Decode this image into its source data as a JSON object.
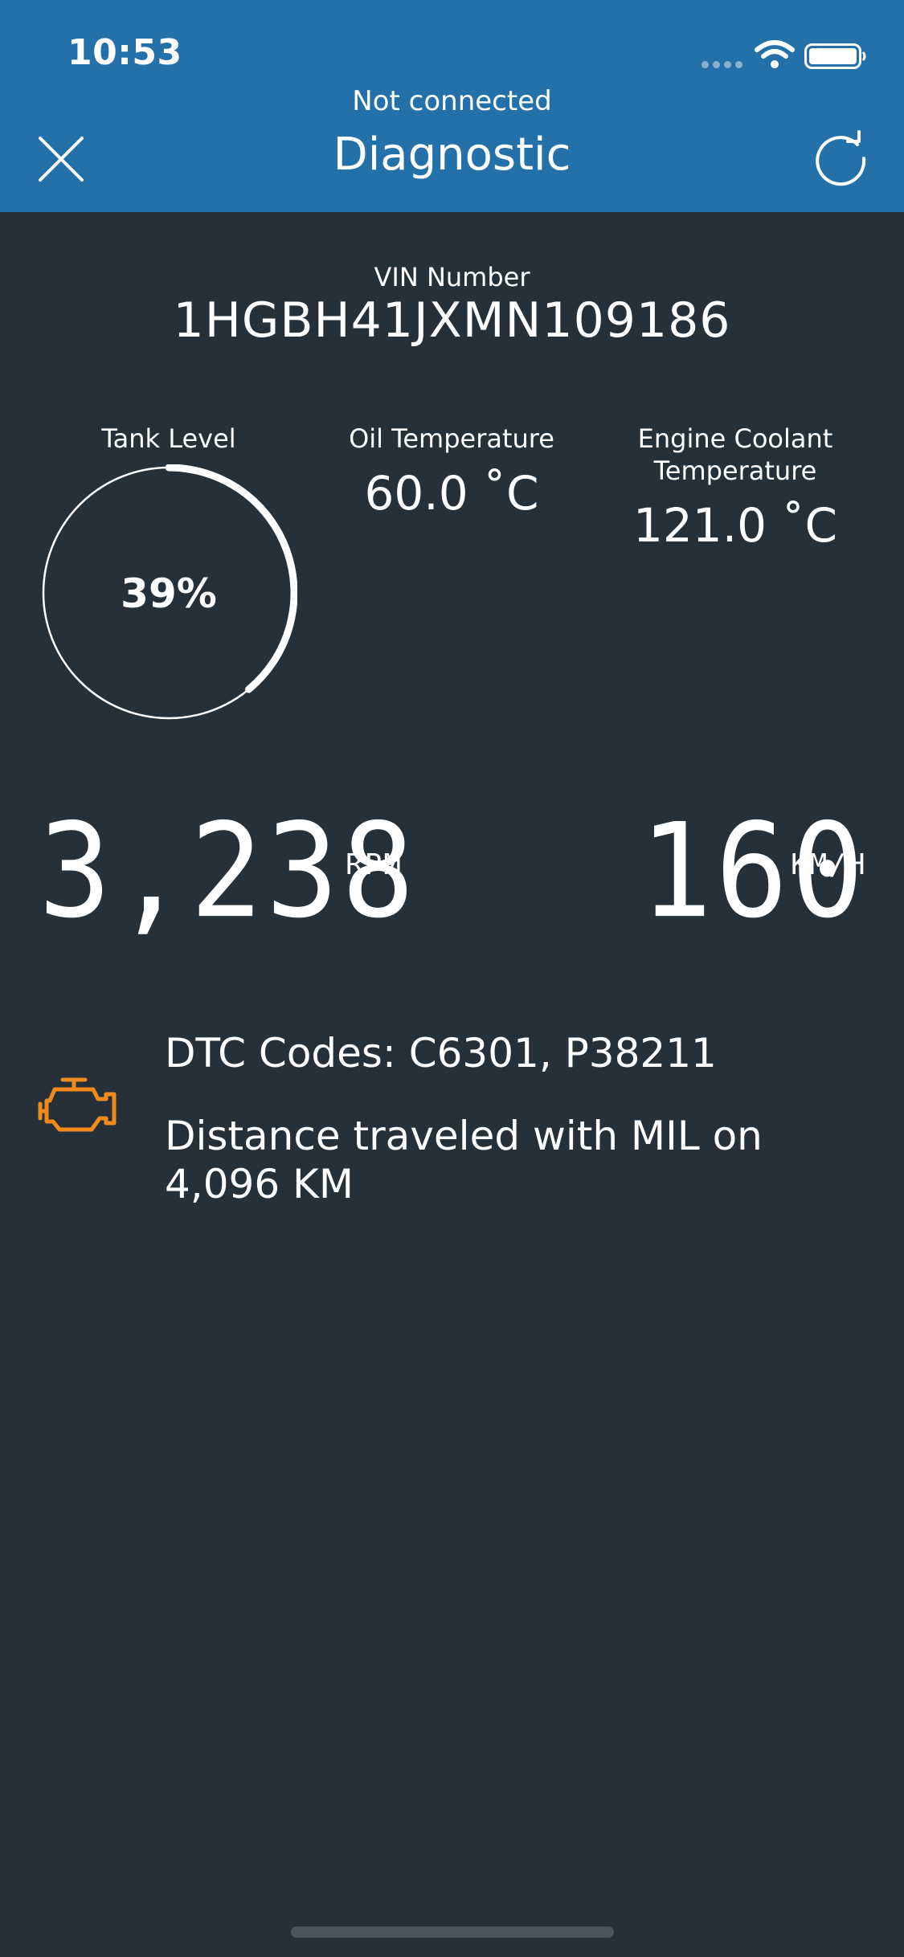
{
  "status_bar": {
    "time": "10:53"
  },
  "header": {
    "subtitle": "Not connected",
    "title": "Diagnostic",
    "close_icon": "close-icon",
    "refresh_icon": "refresh-icon"
  },
  "vin": {
    "label": "VIN Number",
    "value": "1HGBH41JXMN109186"
  },
  "tank": {
    "label": "Tank Level",
    "value_text": "39%",
    "level": 0.39
  },
  "oil": {
    "label": "Oil Temperature",
    "value": "60.0 ˚C"
  },
  "coolant": {
    "label_line1": "Engine Coolant",
    "label_line2": "Temperature",
    "value": "121.0 ˚C"
  },
  "rpm": {
    "value": "3,238",
    "unit": "RPM"
  },
  "speed": {
    "value": "160",
    "unit": "KM/H"
  },
  "dtc": {
    "icon": "check-engine-icon",
    "codes_text": "DTC Codes: C6301, P38211",
    "distance_line1": "Distance traveled with MIL on",
    "distance_line2": "4,096 KM"
  },
  "colors": {
    "header_bg": "#2471aa",
    "page_bg": "#253038",
    "engine_icon": "#f08a1c"
  }
}
